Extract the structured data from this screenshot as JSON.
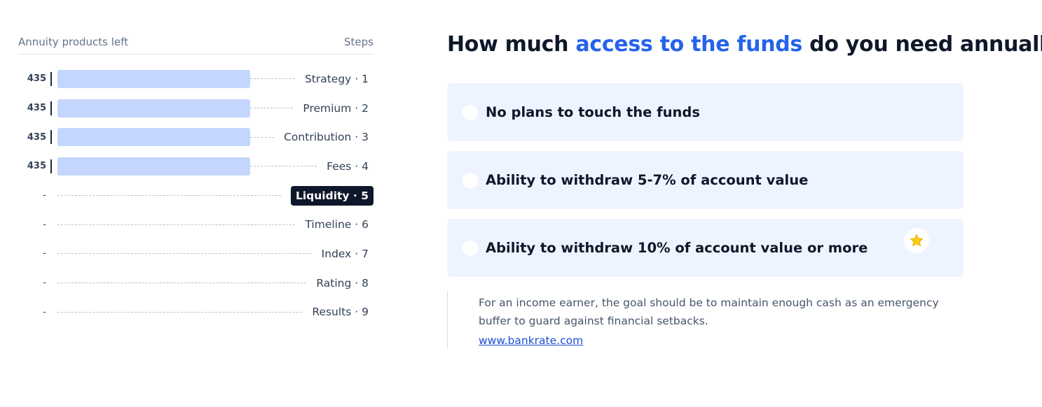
{
  "sidebar": {
    "header_left": "Annuity products left",
    "header_right": "Steps",
    "steps": [
      {
        "count": "435",
        "label": "Strategy · 1",
        "fraction": 1.0
      },
      {
        "count": "435",
        "label": "Premium · 2",
        "fraction": 1.0
      },
      {
        "count": "435",
        "label": "Contribution · 3",
        "fraction": 1.0
      },
      {
        "count": "435",
        "label": "Fees · 4",
        "fraction": 1.0
      },
      {
        "count": "-",
        "label": "Liquidity · 5",
        "active": true
      },
      {
        "count": "-",
        "label": "Timeline · 6"
      },
      {
        "count": "-",
        "label": "Index · 7"
      },
      {
        "count": "-",
        "label": "Rating · 8"
      },
      {
        "count": "-",
        "label": "Results · 9"
      }
    ]
  },
  "question": {
    "prefix": "How much ",
    "highlight": "access to the funds",
    "suffix": " do you need annually?"
  },
  "options": [
    {
      "label": "No plans to touch the funds"
    },
    {
      "label": "Ability to withdraw 5-7% of account value"
    },
    {
      "label": "Ability to withdraw 10% of account value or more",
      "badge_icon": "star-icon"
    }
  ],
  "note": {
    "text": "For an income earner, the goal should be to maintain enough cash as an emergency buffer to guard against financial setbacks.",
    "link": "www.bankrate.com"
  },
  "colors": {
    "accent": "#2563eb",
    "bar": "#c4d6fd",
    "option_bg": "#eef4ff",
    "active_step_bg": "#0f172a",
    "star": "#facc15"
  }
}
